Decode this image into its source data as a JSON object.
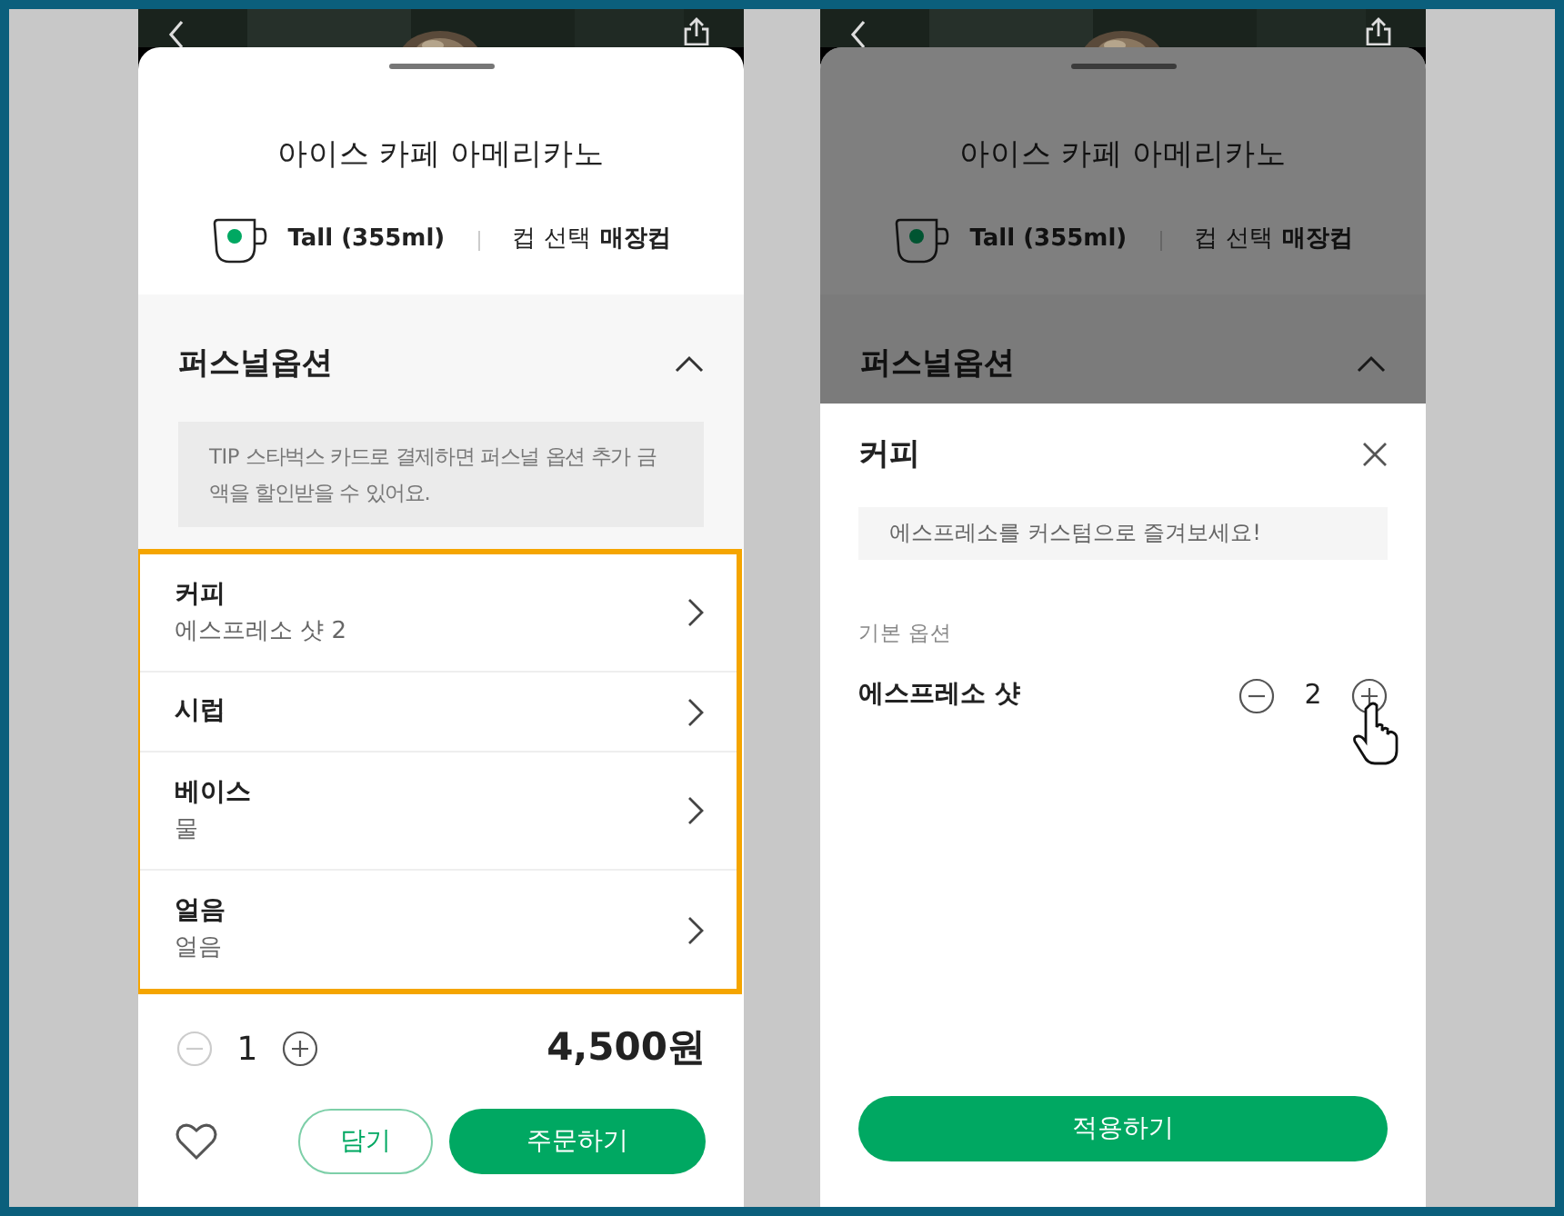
{
  "left_screen": {
    "product": {
      "title": "아이스 카페 아메리카노",
      "size": "Tall (355ml)",
      "cup_label": "컵 선택",
      "cup_value": "매장컵"
    },
    "personal_options": {
      "title": "퍼스널옵션",
      "expanded": true,
      "tip": "TIP 스타벅스 카드로 결제하면 퍼스널 옵션 추가 금액을 할인받을 수 있어요."
    },
    "options_highlighted": true,
    "options": [
      {
        "name": "커피",
        "value": "에스프레소 샷 2"
      },
      {
        "name": "시럽"
      },
      {
        "name": "베이스",
        "value": "물"
      },
      {
        "name": "얼음",
        "value": "얼음"
      }
    ],
    "quantity": {
      "value": "1",
      "decrease_disabled": true
    },
    "price": "4,500원",
    "liked": false,
    "cart_button": "담기",
    "order_button": "주문하기"
  },
  "right_screen": {
    "dimmed": true,
    "product": {
      "title": "아이스 카페 아메리카노",
      "size": "Tall (355ml)",
      "cup_label": "컵 선택",
      "cup_value": "매장컵"
    },
    "personal_options": {
      "title": "퍼스널옵션",
      "expanded": true
    },
    "panel": {
      "title": "커피",
      "hint": "에스프레소를 커스텀으로 즐겨보세요!",
      "section": "기본 옵션",
      "option": {
        "name": "에스프레소 샷",
        "quantity": "2",
        "decrease_disabled": false
      },
      "apply_button": "적용하기"
    }
  }
}
